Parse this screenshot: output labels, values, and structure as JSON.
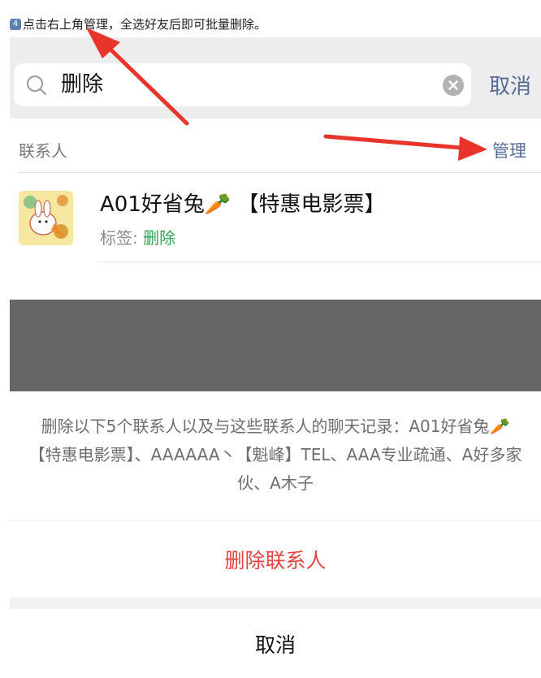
{
  "tip": {
    "badge": "4",
    "text": "点击右上角管理，全选好友后即可批量删除。"
  },
  "search": {
    "query": "删除",
    "cancel_label": "取消"
  },
  "section": {
    "label": "联系人",
    "manage_label": "管理"
  },
  "contact": {
    "name": "A01好省兔🥕 【特惠电影票】",
    "tag_prefix": "标签: ",
    "tag_value": "删除"
  },
  "sheet": {
    "message": "删除以下5个联系人以及与这些联系人的聊天记录：A01好省兔🥕【特惠电影票】、AAAAAA丶【魁峰】TEL、AAA专业疏通、A好多家伙、A木子",
    "delete_label": "删除联系人",
    "cancel_label": "取消"
  },
  "colors": {
    "link": "#576b95",
    "danger": "#e64340",
    "tag_green": "#2ea44f",
    "arrow_red": "#e8342a",
    "overlay": "#666666"
  },
  "icons": [
    "search-icon",
    "clear-icon",
    "avatar-image",
    "annotation-arrow"
  ]
}
